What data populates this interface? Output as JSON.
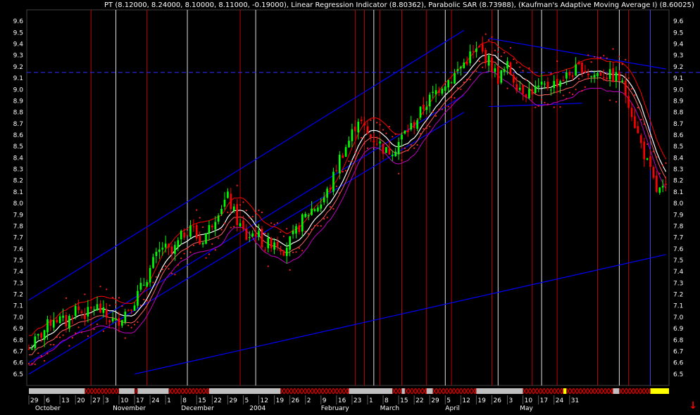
{
  "header": {
    "legend_text": "PT (8.12000, 8.24000, 8.10000, 8.11000, -0.19000), Linear Regression Indicator (8.80362), Parabolic SAR (8.73988), (Kaufman's Adaptive Moving Average I) (8.60025)"
  },
  "colors": {
    "background": "#000000",
    "candle_up": "#00ff00",
    "candle_down": "#ff0000",
    "sar_dots": "#ff2020",
    "trendline": "#0000ff",
    "h_dashed_line": "#3030ff",
    "band_upper": "#ff0000",
    "band_lower": "#c000c0",
    "lin_reg": "#ffffff",
    "kama": "#ff6060",
    "vertical_red": "#c00000",
    "vertical_white": "#e0e0e0",
    "vertical_blue": "#4040ff",
    "axis_text": "#ffffff",
    "strip_gray": "#c0c0c0",
    "strip_hatch": "#ff0000",
    "strip_yellow": "#ffff00"
  },
  "chart_data": {
    "type": "candlestick",
    "title": "PT (8.12000, 8.24000, 8.10000, 8.11000, -0.19000), Linear Regression Indicator (8.80362), Parabolic SAR (8.73988), (Kaufman's Adaptive Moving Average I) (8.60025)",
    "symbol": "PT",
    "last_bar": {
      "open": 8.12,
      "high": 8.24,
      "low": 8.1,
      "close": 8.11,
      "change": -0.19
    },
    "indicators": [
      {
        "name": "Linear Regression Indicator",
        "value": 8.80362
      },
      {
        "name": "Parabolic SAR",
        "value": 8.73988
      },
      {
        "name": "Kaufman's Adaptive Moving Average I",
        "value": 8.60025
      }
    ],
    "ylim": [
      6.4,
      9.7
    ],
    "y_ticks": [
      "6.5",
      "6.6",
      "6.7",
      "6.8",
      "6.9",
      "7.0",
      "7.1",
      "7.2",
      "7.3",
      "7.4",
      "7.5",
      "7.6",
      "7.7",
      "7.8",
      "7.9",
      "8.0",
      "8.1",
      "8.2",
      "8.3",
      "8.4",
      "8.5",
      "8.6",
      "8.7",
      "8.8",
      "8.9",
      "9.0",
      "9.1",
      "9.2",
      "9.3",
      "9.4",
      "9.5",
      "9.6"
    ],
    "x_day_labels": [
      "29",
      "6",
      "13",
      "20",
      "27",
      "3",
      "10",
      "17",
      "24",
      "1",
      "8",
      "15",
      "22",
      "29",
      "5",
      "12",
      "19",
      "26",
      "2",
      "9",
      "16",
      "23",
      "1",
      "8",
      "15",
      "22",
      "29",
      "5",
      "12",
      "19",
      "26",
      "3",
      "10",
      "17",
      "24",
      "31"
    ],
    "x_month_labels": [
      "October",
      "November",
      "December",
      "2004",
      "February",
      "March",
      "April",
      "May"
    ],
    "horizontal_reference": 9.15,
    "grid": false,
    "path": [
      [
        0,
        6.72
      ],
      [
        8,
        6.85
      ],
      [
        16,
        7.0
      ],
      [
        24,
        6.95
      ],
      [
        30,
        7.08
      ],
      [
        37,
        7.02
      ],
      [
        43,
        7.1
      ],
      [
        50,
        7.0
      ],
      [
        56,
        6.95
      ],
      [
        62,
        7.05
      ],
      [
        68,
        7.15
      ],
      [
        74,
        7.3
      ],
      [
        80,
        7.48
      ],
      [
        86,
        7.62
      ],
      [
        92,
        7.55
      ],
      [
        98,
        7.7
      ],
      [
        104,
        7.82
      ],
      [
        110,
        7.65
      ],
      [
        116,
        7.78
      ],
      [
        122,
        7.95
      ],
      [
        128,
        8.05
      ],
      [
        134,
        7.85
      ],
      [
        140,
        7.7
      ],
      [
        146,
        7.75
      ],
      [
        152,
        7.62
      ],
      [
        158,
        7.68
      ],
      [
        164,
        7.6
      ],
      [
        170,
        7.7
      ],
      [
        176,
        7.85
      ],
      [
        182,
        7.95
      ],
      [
        188,
        8.0
      ],
      [
        194,
        8.15
      ],
      [
        200,
        8.4
      ],
      [
        206,
        8.55
      ],
      [
        212,
        8.75
      ],
      [
        218,
        8.6
      ],
      [
        224,
        8.55
      ],
      [
        230,
        8.45
      ],
      [
        236,
        8.5
      ],
      [
        242,
        8.62
      ],
      [
        248,
        8.7
      ],
      [
        254,
        8.85
      ],
      [
        260,
        8.95
      ],
      [
        266,
        9.05
      ],
      [
        272,
        9.1
      ],
      [
        278,
        9.2
      ],
      [
        284,
        9.3
      ],
      [
        290,
        9.35
      ],
      [
        296,
        9.25
      ],
      [
        302,
        9.1
      ],
      [
        308,
        9.2
      ],
      [
        314,
        9.05
      ],
      [
        320,
        8.98
      ],
      [
        326,
        9.0
      ],
      [
        332,
        9.02
      ],
      [
        338,
        9.05
      ],
      [
        344,
        9.1
      ],
      [
        350,
        9.15
      ],
      [
        356,
        9.2
      ],
      [
        362,
        9.12
      ],
      [
        368,
        9.15
      ],
      [
        374,
        9.12
      ],
      [
        380,
        9.1
      ],
      [
        386,
        8.9
      ],
      [
        392,
        8.6
      ],
      [
        398,
        8.35
      ],
      [
        404,
        8.11
      ]
    ],
    "candles_count": 205,
    "last_day_index": 205,
    "series": [
      {
        "name": "Linear Regression Indicator",
        "last": 8.80362
      },
      {
        "name": "Parabolic SAR",
        "last": 8.73988
      },
      {
        "name": "Kaufman's Adaptive Moving Average I",
        "last": 8.60025
      }
    ],
    "vertical_markers": [
      {
        "day": 20,
        "color": "red"
      },
      {
        "day": 28,
        "color": "white"
      },
      {
        "day": 38,
        "color": "red"
      },
      {
        "day": 51,
        "color": "white"
      },
      {
        "day": 68,
        "color": "red"
      },
      {
        "day": 73,
        "color": "white"
      },
      {
        "day": 105,
        "color": "red"
      },
      {
        "day": 108,
        "color": "red"
      },
      {
        "day": 111,
        "color": "white"
      },
      {
        "day": 113,
        "color": "red"
      },
      {
        "day": 120,
        "color": "red"
      },
      {
        "day": 128,
        "color": "red"
      },
      {
        "day": 134,
        "color": "white"
      },
      {
        "day": 136,
        "color": "red"
      },
      {
        "day": 149,
        "color": "red"
      },
      {
        "day": 151,
        "color": "white"
      },
      {
        "day": 162,
        "color": "red"
      },
      {
        "day": 165,
        "color": "white"
      },
      {
        "day": 170,
        "color": "red"
      },
      {
        "day": 183,
        "color": "red"
      },
      {
        "day": 190,
        "color": "white"
      },
      {
        "day": 193,
        "color": "red"
      },
      {
        "day": 200,
        "color": "blue"
      }
    ],
    "trendlines": [
      {
        "from": [
          0,
          7.15
        ],
        "to": [
          140,
          9.52
        ]
      },
      {
        "from": [
          0,
          6.6
        ],
        "to": [
          140,
          8.95
        ]
      },
      {
        "from": [
          0,
          6.5
        ],
        "to": [
          140,
          8.8
        ]
      },
      {
        "from": [
          34,
          6.5
        ],
        "to": [
          205,
          7.55
        ]
      },
      {
        "from": [
          148,
          9.45
        ],
        "to": [
          205,
          9.18
        ]
      },
      {
        "from": [
          148,
          8.85
        ],
        "to": [
          178,
          8.88
        ]
      }
    ],
    "strip": [
      {
        "from": 0,
        "to": 18,
        "kind": "gray"
      },
      {
        "from": 18,
        "to": 29,
        "kind": "hatch"
      },
      {
        "from": 29,
        "to": 34,
        "kind": "gray"
      },
      {
        "from": 34,
        "to": 35,
        "kind": "hatch"
      },
      {
        "from": 35,
        "to": 45,
        "kind": "gray"
      },
      {
        "from": 45,
        "to": 58,
        "kind": "hatch"
      },
      {
        "from": 58,
        "to": 81,
        "kind": "gray"
      },
      {
        "from": 81,
        "to": 103,
        "kind": "hatch"
      },
      {
        "from": 103,
        "to": 117,
        "kind": "gray"
      },
      {
        "from": 117,
        "to": 120,
        "kind": "hatch"
      },
      {
        "from": 120,
        "to": 121,
        "kind": "gray"
      },
      {
        "from": 121,
        "to": 128,
        "kind": "hatch"
      },
      {
        "from": 128,
        "to": 130,
        "kind": "gray"
      },
      {
        "from": 130,
        "to": 144,
        "kind": "hatch"
      },
      {
        "from": 144,
        "to": 159,
        "kind": "gray"
      },
      {
        "from": 159,
        "to": 172,
        "kind": "hatch"
      },
      {
        "from": 172,
        "to": 173,
        "kind": "yellow"
      },
      {
        "from": 173,
        "to": 188,
        "kind": "hatch"
      },
      {
        "from": 188,
        "to": 190,
        "kind": "gray"
      },
      {
        "from": 190,
        "to": 200,
        "kind": "hatch"
      },
      {
        "from": 200,
        "to": 206,
        "kind": "yellow"
      }
    ],
    "day_label_positions": [
      0,
      5,
      10,
      15,
      20,
      24,
      29,
      34,
      39,
      44,
      49,
      54,
      59,
      64,
      69,
      74,
      79,
      84,
      89,
      94,
      99,
      104,
      109,
      114,
      119,
      124,
      129,
      134,
      139,
      144,
      149,
      154,
      159,
      164,
      169,
      174
    ]
  }
}
